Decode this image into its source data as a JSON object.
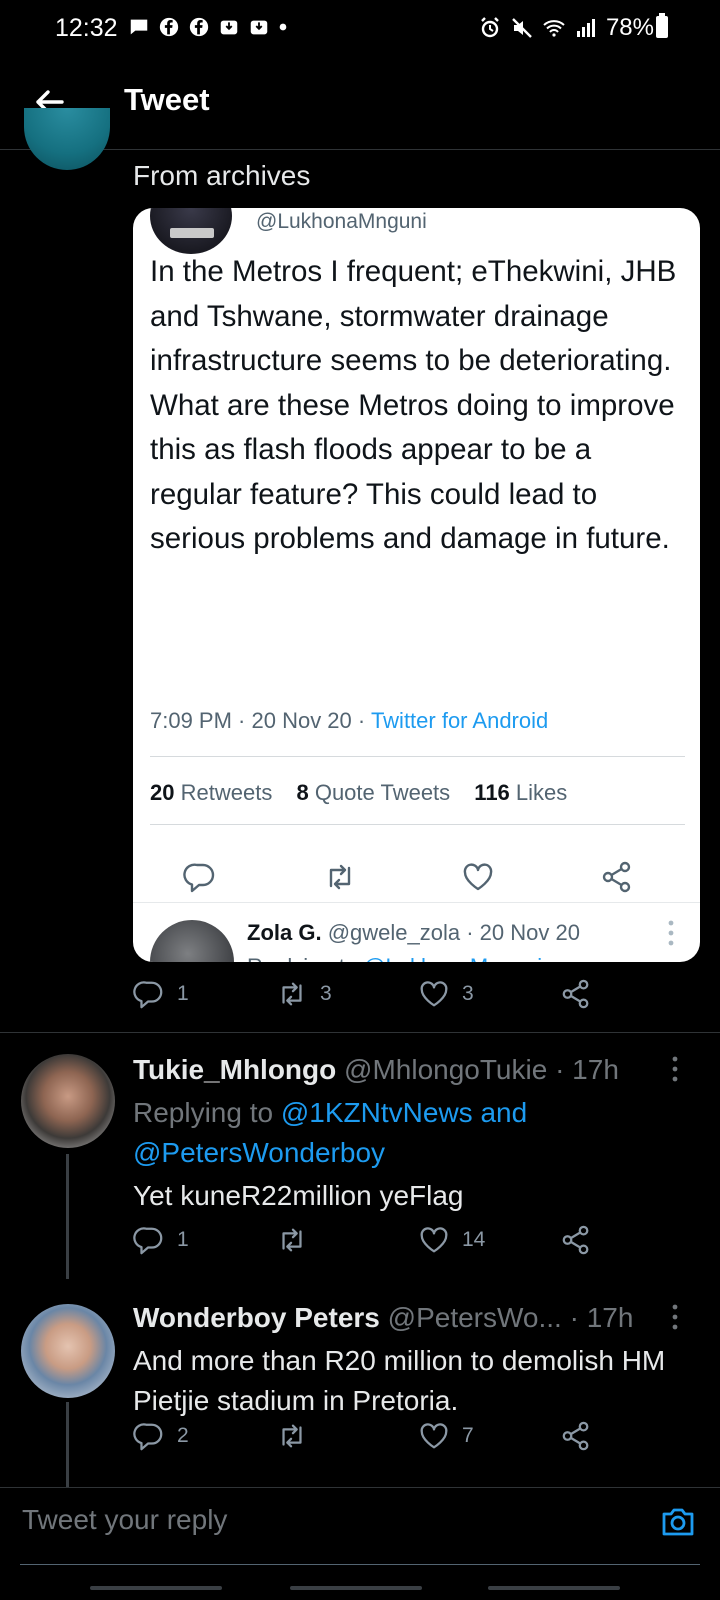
{
  "status_bar": {
    "time": "12:32",
    "battery": "78%"
  },
  "header": {
    "title": "Tweet"
  },
  "top_tweet": {
    "text": "From archives"
  },
  "quoted": {
    "handle": "@LukhonaMnguni",
    "text": "In the Metros I frequent; eThekwini, JHB and Tshwane, stormwater drainage infrastructure seems to be deteriorating. What are these Metros doing to improve this as flash floods appear to be a regular feature? This could lead to serious problems and damage in future.",
    "time": "7:09 PM · 20 Nov 20 · ",
    "source": "Twitter for Android",
    "retweets_count": "20",
    "retweets_label": "Retweets",
    "quotes_count": "8",
    "quotes_label": "Quote Tweets",
    "likes_count": "116",
    "likes_label": "Likes",
    "reply": {
      "name": "Zola G.",
      "meta": "@gwele_zola · 20 Nov 20",
      "replying_prefix": "Replying to ",
      "replying_handle": "@LukhonaMnguni"
    }
  },
  "top_actions": {
    "replies": "1",
    "retweets": "3",
    "likes": "3"
  },
  "replies": [
    {
      "name": "Tukie_Mhlongo",
      "meta": "@MhlongoTukie · 17h",
      "replying_prefix": "Replying to ",
      "replying_to": "@1KZNtvNews and @PetersWonderboy",
      "text": "Yet kuneR22million yeFlag",
      "replies": "1",
      "retweets": "",
      "likes": "14"
    },
    {
      "name": "Wonderboy Peters",
      "meta": "@PetersWo...  · 17h",
      "text": "And more than R20 million to demolish HM Pietjie stadium in Pretoria.",
      "replies": "2",
      "retweets": "",
      "likes": "7"
    }
  ],
  "composer": {
    "placeholder": "Tweet your reply"
  },
  "colors": {
    "background": "#000000",
    "accent": "#1d9bf0",
    "card": "#ffffff",
    "muted": "#71767b"
  }
}
